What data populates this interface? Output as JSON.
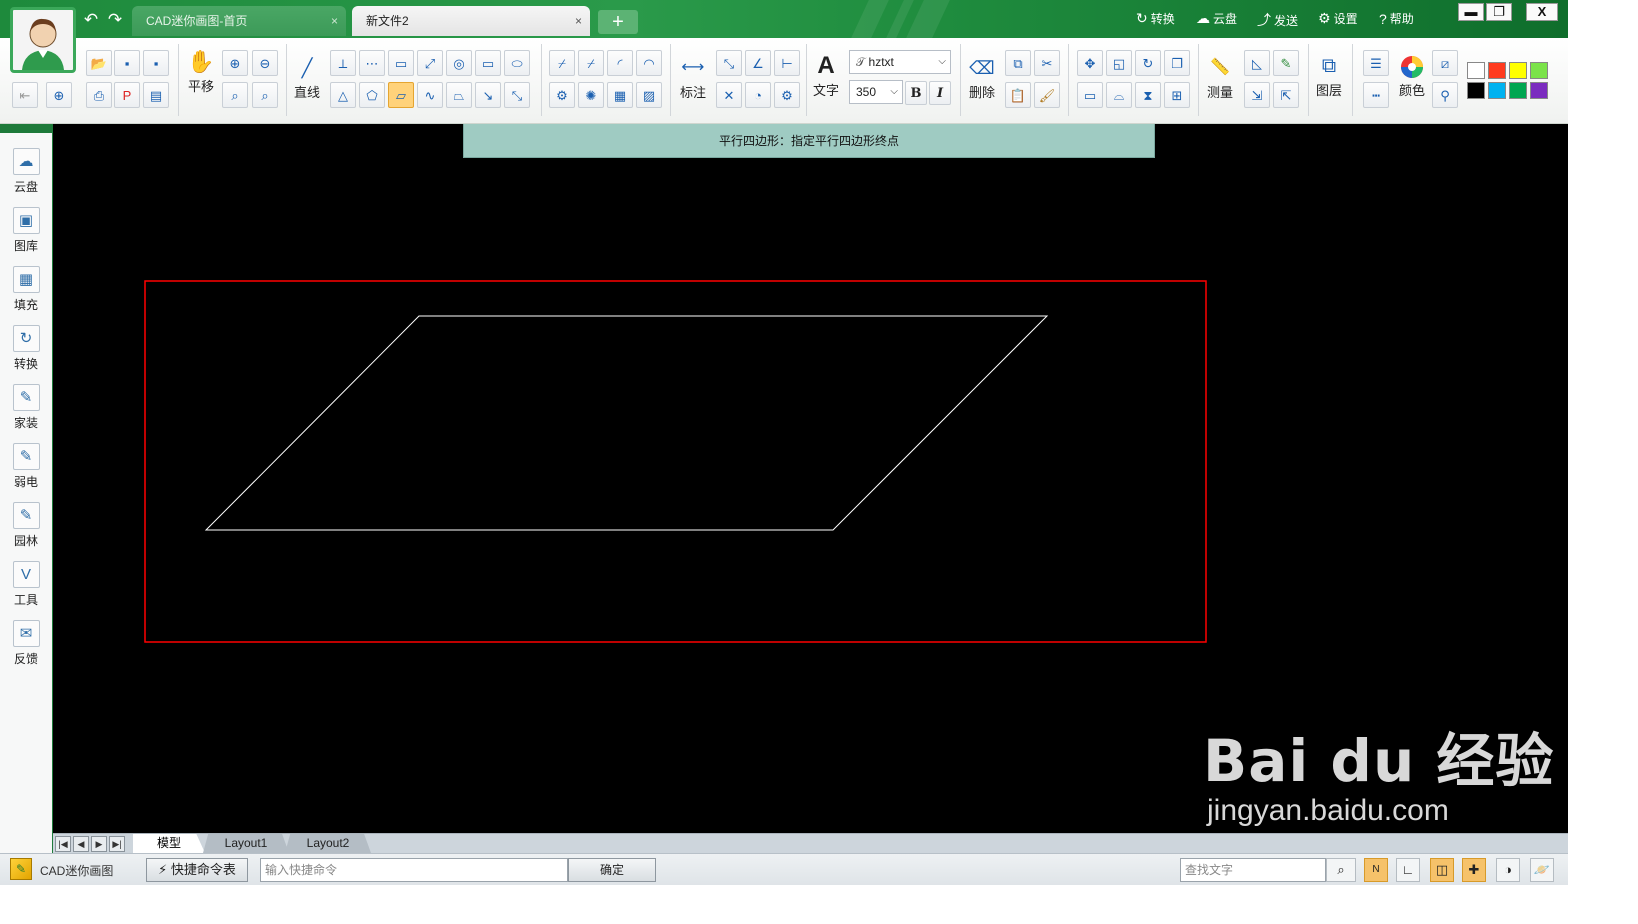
{
  "app": {
    "name": "CAD迷你画图"
  },
  "tabs": [
    {
      "label": "CAD迷你画图-首页",
      "close": "×"
    },
    {
      "label": "新文件2",
      "close": "×"
    }
  ],
  "add_tab": "+",
  "top_menu": [
    {
      "label": "转换",
      "icon": "↻"
    },
    {
      "label": "云盘",
      "icon": "☁"
    },
    {
      "label": "发送",
      "icon": "⤴"
    },
    {
      "label": "设置",
      "icon": "⚙"
    },
    {
      "label": "帮助",
      "icon": "?"
    }
  ],
  "window_controls": {
    "minimize": "▬",
    "maximize": "❐",
    "close": "X"
  },
  "ribbon": {
    "pan_label": "平移",
    "line_label": "直线",
    "dimension_label": "标注",
    "text_label": "文字",
    "text_glyph": "A",
    "font_name": "hztxt",
    "font_size": "350",
    "bold": "B",
    "italic": "I",
    "delete_label": "删除",
    "measure_label": "测量",
    "layer_label": "图层",
    "color_label": "颜色",
    "swatches": [
      "#ffffff",
      "#ff3b1f",
      "#ffff00",
      "#7be34a",
      "#000000",
      "#00b2f0",
      "#00a651",
      "#7b2cbf"
    ]
  },
  "sidebar": [
    {
      "label": "云盘",
      "icon": "cloud-icon",
      "glyph": "☁"
    },
    {
      "label": "图库",
      "icon": "gallery-icon",
      "glyph": "▣"
    },
    {
      "label": "填充",
      "icon": "hatch-icon",
      "glyph": "▦"
    },
    {
      "label": "转换",
      "icon": "convert-icon",
      "glyph": "↻"
    },
    {
      "label": "家装",
      "icon": "home-decor-icon",
      "glyph": "✎"
    },
    {
      "label": "弱电",
      "icon": "low-voltage-icon",
      "glyph": "✎"
    },
    {
      "label": "园林",
      "icon": "garden-icon",
      "glyph": "✎"
    },
    {
      "label": "工具",
      "icon": "tools-icon",
      "glyph": "V"
    },
    {
      "label": "反馈",
      "icon": "feedback-icon",
      "glyph": "✉"
    }
  ],
  "canvas": {
    "prompt": "平行四边形：指定平行四边形终点",
    "background": "#000000",
    "selection_color": "#ff0000",
    "shape_color": "#ffffff"
  },
  "watermark": {
    "main": "Bai du 经验",
    "sub": "jingyan.baidu.com"
  },
  "layout_tabs": [
    "模型",
    "Layout1",
    "Layout2"
  ],
  "statusbar": {
    "app_label": "CAD迷你画图",
    "shortcut_button": "快捷命令表",
    "command_placeholder": "输入快捷命令",
    "confirm": "确定",
    "search_placeholder": "查找文字"
  }
}
